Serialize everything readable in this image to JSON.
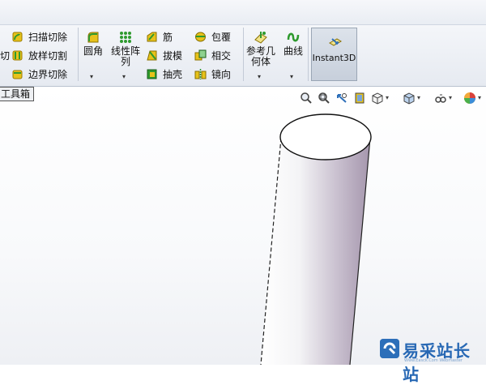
{
  "ribbon": {
    "features_col1": [
      {
        "label": "切",
        "icon": "cut-icon"
      },
      {
        "label": "",
        "icon": ""
      }
    ],
    "features_col2": [
      {
        "label": "扫描切除",
        "icon": "sweep-cut-icon"
      },
      {
        "label": "放样切割",
        "icon": "loft-cut-icon"
      },
      {
        "label": "边界切除",
        "icon": "boundary-cut-icon"
      }
    ],
    "fillet": {
      "label": "圆角",
      "icon": "fillet-icon"
    },
    "linear_pattern": {
      "label_line1": "线性阵",
      "label_line2": "列",
      "icon": "linear-pattern-icon"
    },
    "features_col3": [
      {
        "label": "筋",
        "icon": "rib-icon"
      },
      {
        "label": "拔模",
        "icon": "draft-icon"
      },
      {
        "label": "抽壳",
        "icon": "shell-icon"
      }
    ],
    "features_col4": [
      {
        "label": "包覆",
        "icon": "wrap-icon"
      },
      {
        "label": "相交",
        "icon": "intersect-icon"
      },
      {
        "label": "镜向",
        "icon": "mirror-icon"
      }
    ],
    "reference_geometry": {
      "label_line1": "参考几",
      "label_line2": "何体",
      "icon": "reference-geometry-icon"
    },
    "curves": {
      "label": "曲线",
      "icon": "curves-icon"
    },
    "instant3d": {
      "label": "Instant3D",
      "icon": "instant3d-icon"
    }
  },
  "toolbox_tab": {
    "label": "工具箱"
  },
  "watermark": {
    "text": "易采站长站",
    "sub": "Www.Easck.Com Webmaster"
  },
  "colors": {
    "accent": "#2d6fb9",
    "icon_green": "#2e9a2e",
    "icon_yellow": "#e7c21a"
  }
}
